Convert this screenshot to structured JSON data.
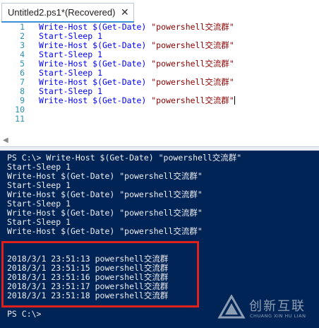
{
  "editor": {
    "tab": {
      "title": "Untitled2.ps1*(Recovered)",
      "close_glyph": "✕"
    },
    "line_numbers": [
      "1",
      "2",
      "3",
      "4",
      "5",
      "6",
      "7",
      "8",
      "9",
      "10",
      "11"
    ],
    "lines": [
      {
        "cmd": "Write-Host $(Get-Date) ",
        "str": "\"powershell交流群\""
      },
      {
        "cmd": "Start-Sleep 1",
        "str": ""
      },
      {
        "cmd": "Write-Host $(Get-Date) ",
        "str": "\"powershell交流群\""
      },
      {
        "cmd": "Start-Sleep 1",
        "str": ""
      },
      {
        "cmd": "Write-Host $(Get-Date) ",
        "str": "\"powershell交流群\""
      },
      {
        "cmd": "Start-Sleep 1",
        "str": ""
      },
      {
        "cmd": "Write-Host $(Get-Date) ",
        "str": "\"powershell交流群\""
      },
      {
        "cmd": "Start-Sleep 1",
        "str": ""
      },
      {
        "cmd": "Write-Host $(Get-Date) ",
        "str": "\"powershell交流群\""
      },
      {
        "cmd": "",
        "str": ""
      },
      {
        "cmd": "",
        "str": ""
      }
    ],
    "scroll_left_glyph": "◀"
  },
  "console": {
    "echo_lines": [
      "PS C:\\> Write-Host $(Get-Date) \"powershell交流群\"",
      "Start-Sleep 1",
      "Write-Host $(Get-Date) \"powershell交流群\"",
      "Start-Sleep 1",
      "Write-Host $(Get-Date) \"powershell交流群\"",
      "Start-Sleep 1",
      "Write-Host $(Get-Date) \"powershell交流群\"",
      "Start-Sleep 1",
      "Write-Host $(Get-Date) \"powershell交流群\""
    ],
    "output_lines": [
      "2018/3/1 23:51:13 powershell交流群",
      "2018/3/1 23:51:15 powershell交流群",
      "2018/3/1 23:51:16 powershell交流群",
      "2018/3/1 23:51:17 powershell交流群",
      "2018/3/1 23:51:18 powershell交流群"
    ],
    "prompt": "PS C:\\>",
    "highlight_color": "#e0201a"
  },
  "watermark": {
    "text_cn": "创新互联",
    "text_en": "CHUANG XIN HU LIAN"
  },
  "colors": {
    "console_bg": "#012456",
    "keyword_blue": "#0000ff",
    "string_red": "#8b0000",
    "line_number": "#2b91af"
  }
}
